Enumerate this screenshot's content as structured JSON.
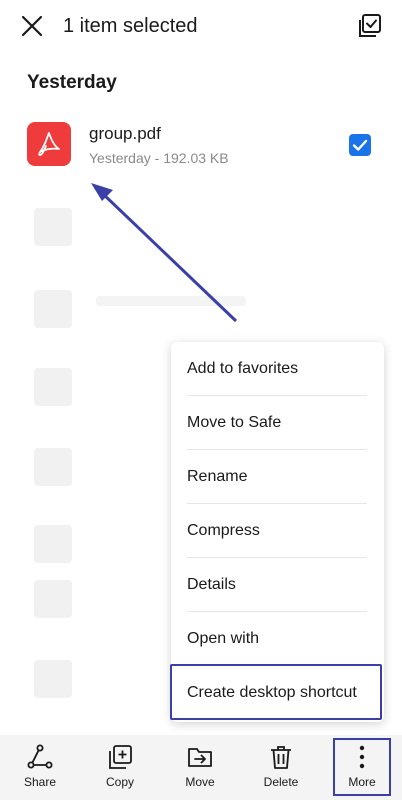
{
  "header": {
    "title": "1 item selected",
    "close_icon": "close-icon",
    "select_all_icon": "select-all-icon"
  },
  "section": {
    "label": "Yesterday"
  },
  "file": {
    "name": "group.pdf",
    "meta": "Yesterday - 192.03 KB",
    "icon": "pdf-icon",
    "selected": true
  },
  "menu": {
    "items": [
      {
        "label": "Add to favorites"
      },
      {
        "label": "Move to Safe"
      },
      {
        "label": "Rename"
      },
      {
        "label": "Compress"
      },
      {
        "label": "Details"
      },
      {
        "label": "Open with"
      },
      {
        "label": "Create desktop shortcut"
      }
    ]
  },
  "bottom_bar": {
    "items": [
      {
        "label": "Share",
        "icon": "share-icon"
      },
      {
        "label": "Copy",
        "icon": "copy-icon"
      },
      {
        "label": "Move",
        "icon": "move-icon"
      },
      {
        "label": "Delete",
        "icon": "delete-icon"
      },
      {
        "label": "More",
        "icon": "more-icon"
      }
    ]
  },
  "colors": {
    "accent": "#1a73e8",
    "pdf_red": "#ef3b3b",
    "annotation": "#3b3fa8",
    "bottom_bar_bg": "#f4f4f4"
  }
}
